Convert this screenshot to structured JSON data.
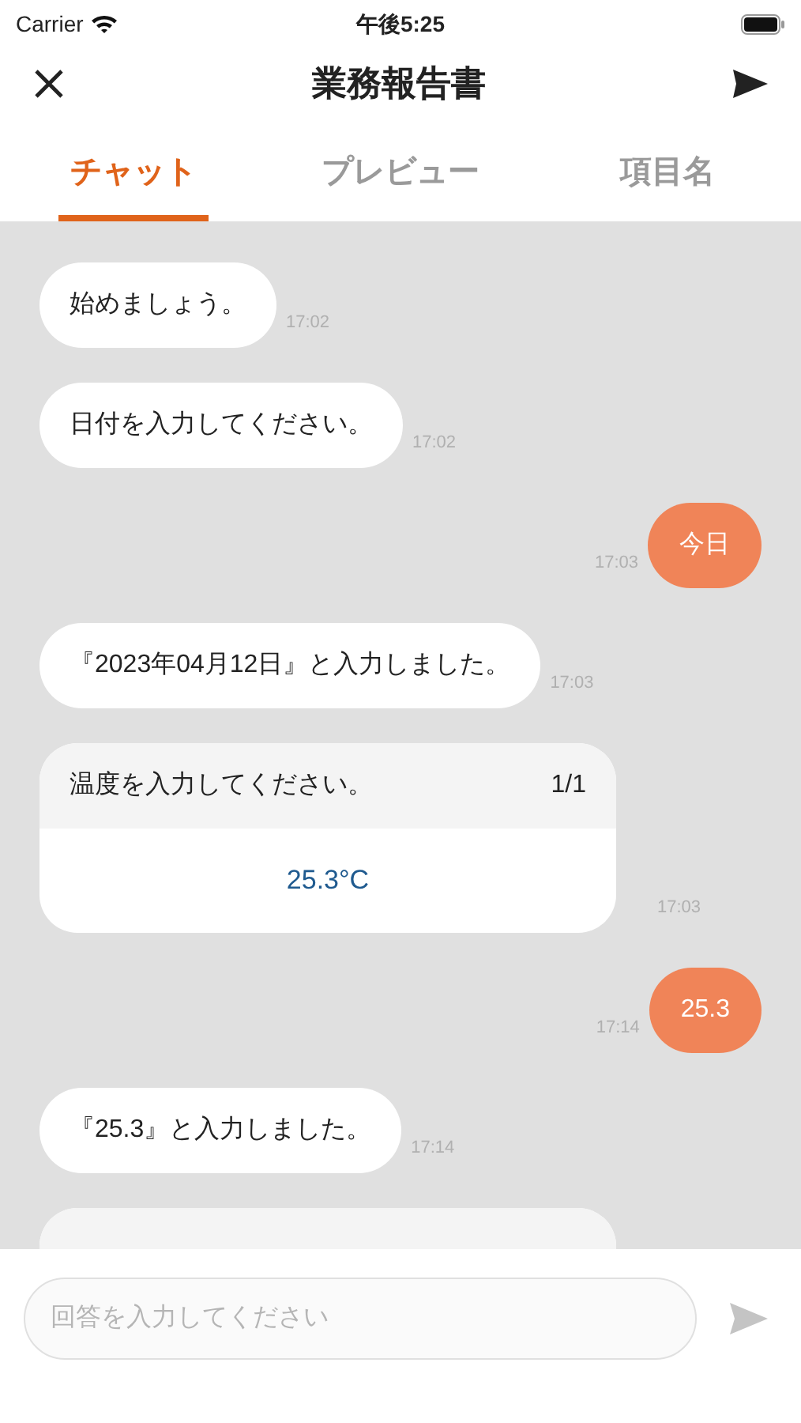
{
  "status_bar": {
    "carrier": "Carrier",
    "time": "午後5:25"
  },
  "nav": {
    "title": "業務報告書"
  },
  "tabs": [
    {
      "label": "チャット",
      "selected": true
    },
    {
      "label": "プレビュー",
      "selected": false
    },
    {
      "label": "項目名",
      "selected": false
    }
  ],
  "messages": [
    {
      "kind": "bot",
      "text": "始めましょう。",
      "time": "17:02"
    },
    {
      "kind": "bot",
      "text": "日付を入力してください。",
      "time": "17:02"
    },
    {
      "kind": "user",
      "text": "今日",
      "time": "17:03"
    },
    {
      "kind": "bot",
      "text": "『2023年04月12日』と入力しました。",
      "time": "17:03"
    },
    {
      "kind": "question",
      "text": "温度を入力してください。",
      "count": "1/1",
      "value": "25.3°C",
      "time": "17:03"
    },
    {
      "kind": "user",
      "text": "25.3",
      "time": "17:14"
    },
    {
      "kind": "bot",
      "text": "『25.3』と入力しました。",
      "time": "17:14"
    },
    {
      "kind": "question"
    }
  ],
  "input": {
    "placeholder": "回答を入力してください"
  }
}
